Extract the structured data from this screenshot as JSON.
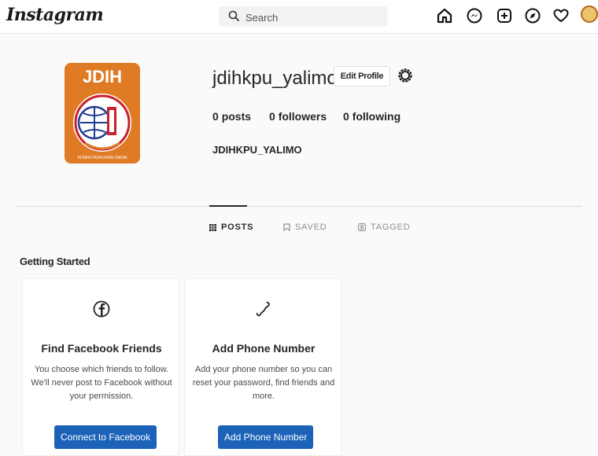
{
  "header": {
    "logo": "Instagram",
    "search_placeholder": "Search",
    "icons": [
      "home-icon",
      "messenger-icon",
      "new-post-icon",
      "explore-icon",
      "activity-heart-icon",
      "profile-avatar"
    ]
  },
  "profile": {
    "username": "jdihkpu_yalimo",
    "edit_label": "Edit Profile",
    "posts_count": "0",
    "posts_label": "posts",
    "followers_count": "0",
    "followers_label": "followers",
    "following_count": "0",
    "following_label": "following",
    "full_name": "JDIHKPU_YALIMO",
    "logo_text": "JDIH",
    "logo_caption": "KOMISI PEMILIHAN UMUM"
  },
  "tabs": [
    {
      "label": "POSTS",
      "icon": "grid-icon",
      "active": true
    },
    {
      "label": "SAVED",
      "icon": "bookmark-icon",
      "active": false
    },
    {
      "label": "TAGGED",
      "icon": "tag-person-icon",
      "active": false
    }
  ],
  "getting_started": {
    "title": "Getting Started",
    "cards": [
      {
        "icon": "facebook-icon",
        "title": "Find Facebook Friends",
        "text": "You choose which friends to follow. We'll never post to Facebook without your permission.",
        "button": "Connect to Facebook"
      },
      {
        "icon": "phone-icon",
        "title": "Add Phone Number",
        "text": "Add your phone number so you can reset your password, find friends and more.",
        "button": "Add Phone Number"
      }
    ]
  },
  "colors": {
    "primary_button": "#1c62b9",
    "logo_orange": "#e07b25",
    "logo_red": "#c8202f"
  }
}
